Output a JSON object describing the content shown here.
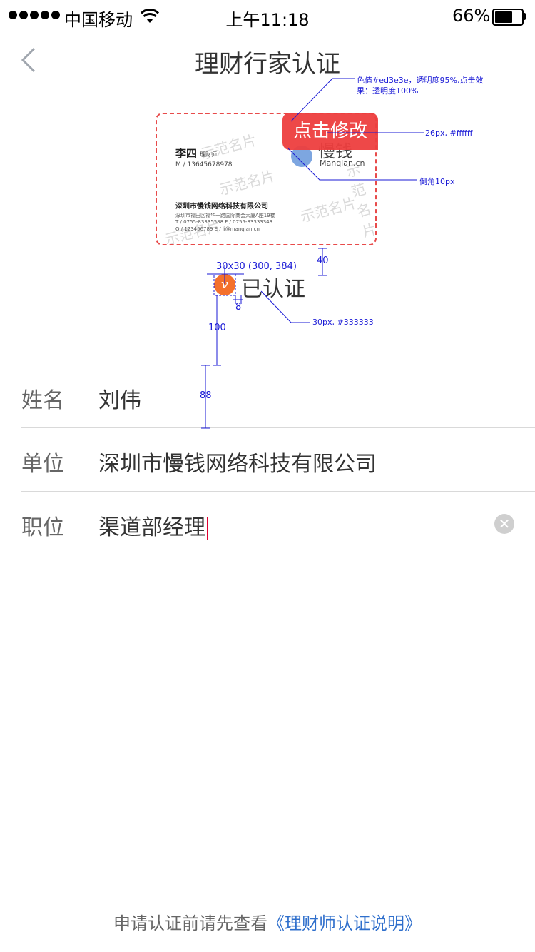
{
  "status_bar": {
    "carrier": "中国移动",
    "time": "上午11:18",
    "battery": "66%",
    "battery_level": 0.66
  },
  "nav": {
    "back_icon": "chevron-left-icon",
    "title": "理财行家认证"
  },
  "card": {
    "name": "李四",
    "role": "理财师",
    "phone": "M / 13645678978",
    "company": "深圳市慢钱网络科技有限公司",
    "address": "深圳市福田区福华一路国际商会大厦A座19楼",
    "tel_fax": "T / 0755-83335588   F / 0755-83333343",
    "qq_email": "Q / 123456789     E / li@manqian.cn",
    "brand": "慢钱",
    "domain": "Manqian.cn",
    "watermark": "示范名片",
    "edit_button": "点击修改"
  },
  "verified": {
    "icon_glyph": "v",
    "text": "已认证"
  },
  "form": {
    "rows": [
      {
        "label": "姓名",
        "value": "刘伟"
      },
      {
        "label": "单位",
        "value": "深圳市慢钱网络科技有限公司"
      },
      {
        "label": "职位",
        "value": "渠道部经理"
      }
    ]
  },
  "footer": {
    "prefix": "申请认证前请先查看",
    "link": "《理财师认证说明》"
  },
  "annotations": {
    "color_note": "色值#ed3e3e，透明度95%,点击效",
    "color_note2": "果：透明度100%",
    "font_note": "26px, #ffffff",
    "radius_note": "倒角10px",
    "gap_40": "40",
    "icon_note": "30x30 (300, 384)",
    "gap_8": "8",
    "gap_100": "100",
    "text_note": "30px, #333333",
    "gap_88": "88"
  },
  "colors": {
    "accent_red": "#ed3e3e",
    "link_blue": "#2f6fcc",
    "verified_orange": "#f4702b",
    "annotation_blue": "#1a1ad6"
  }
}
